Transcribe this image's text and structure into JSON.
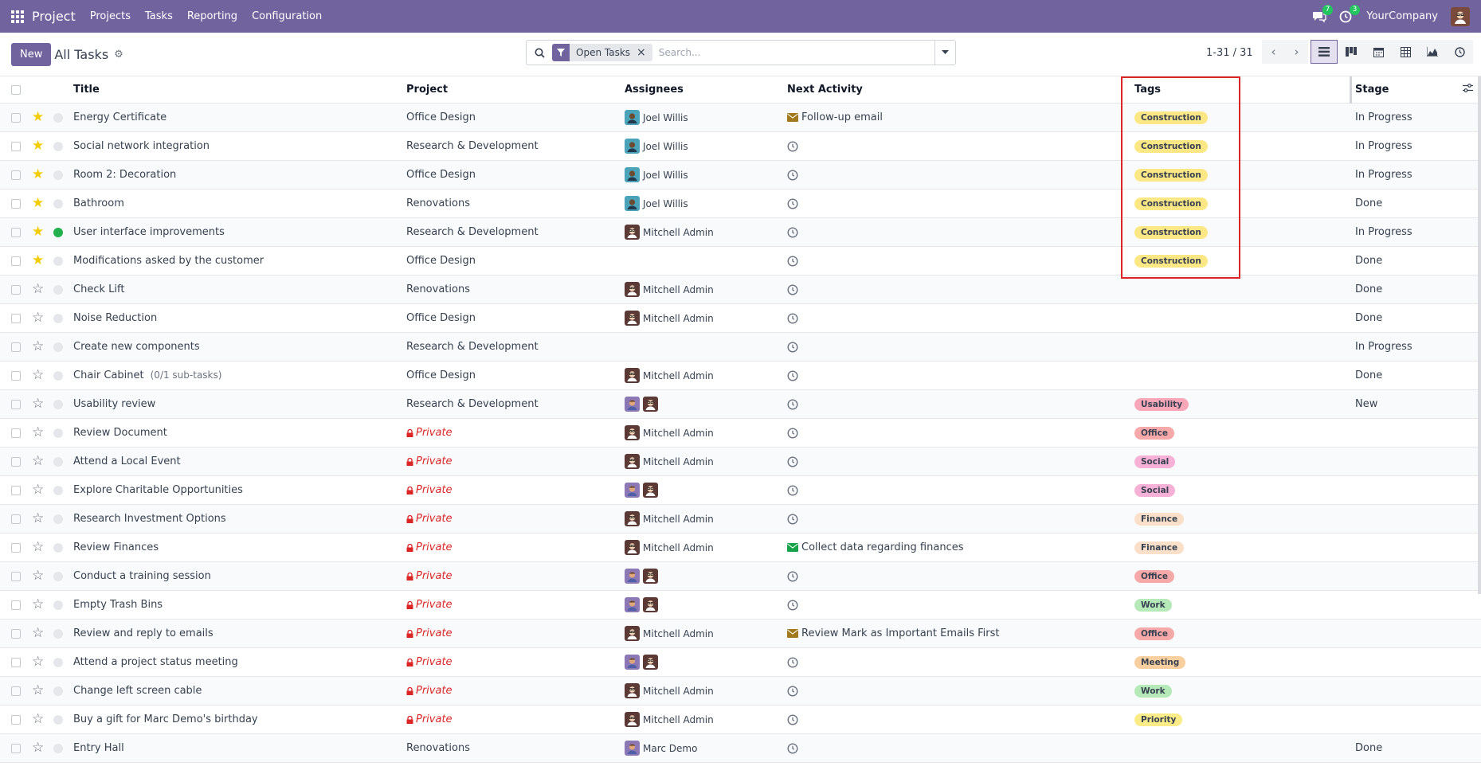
{
  "navbar": {
    "app_name": "Project",
    "menu": [
      "Projects",
      "Tasks",
      "Reporting",
      "Configuration"
    ],
    "messages_count": "7",
    "activities_count": "3",
    "company": "YourCompany",
    "brand_color": "#71639e"
  },
  "control": {
    "new_label": "New",
    "breadcrumb": "All Tasks",
    "filter_facet": "Open Tasks",
    "search_placeholder": "Search...",
    "pager": "1-31 / 31"
  },
  "columns": {
    "title": "Title",
    "project": "Project",
    "assignees": "Assignees",
    "next_activity": "Next Activity",
    "tags": "Tags",
    "stage": "Stage"
  },
  "tag_colors": {
    "Construction": "#fbe784",
    "Usability": "#f8a6b8",
    "Office": "#f7a8a8",
    "Social": "#f7b0d6",
    "Finance": "#fadfc9",
    "Work": "#b6e9b8",
    "Meeting": "#f9cfa0",
    "Priority": "#fbec88"
  },
  "rows": [
    {
      "title": "Energy Certificate",
      "sub": "",
      "starred": true,
      "dot": "",
      "project": "Office Design",
      "private": false,
      "assignees": [
        "joel"
      ],
      "assignee_label": "Joel Willis",
      "activity_type": "email",
      "activity_color": "#a07a1c",
      "activity": "Follow-up email",
      "tag": "Construction",
      "stage": "In Progress"
    },
    {
      "title": "Social network integration",
      "sub": "",
      "starred": true,
      "dot": "",
      "project": "Research & Development",
      "private": false,
      "assignees": [
        "joel"
      ],
      "assignee_label": "Joel Willis",
      "activity_type": "clock",
      "activity": "",
      "tag": "Construction",
      "stage": "In Progress"
    },
    {
      "title": "Room 2: Decoration",
      "sub": "",
      "starred": true,
      "dot": "",
      "project": "Office Design",
      "private": false,
      "assignees": [
        "joel"
      ],
      "assignee_label": "Joel Willis",
      "activity_type": "clock",
      "activity": "",
      "tag": "Construction",
      "stage": "In Progress"
    },
    {
      "title": "Bathroom",
      "sub": "",
      "starred": true,
      "dot": "",
      "project": "Renovations",
      "private": false,
      "assignees": [
        "joel"
      ],
      "assignee_label": "Joel Willis",
      "activity_type": "clock",
      "activity": "",
      "tag": "Construction",
      "stage": "Done"
    },
    {
      "title": "User interface improvements",
      "sub": "",
      "starred": true,
      "dot": "green",
      "project": "Research & Development",
      "private": false,
      "assignees": [
        "mitch"
      ],
      "assignee_label": "Mitchell Admin",
      "activity_type": "clock",
      "activity": "",
      "tag": "Construction",
      "stage": "In Progress"
    },
    {
      "title": "Modifications asked by the customer",
      "sub": "",
      "starred": true,
      "dot": "",
      "project": "Office Design",
      "private": false,
      "assignees": [],
      "assignee_label": "",
      "activity_type": "clock",
      "activity": "",
      "tag": "Construction",
      "stage": "Done"
    },
    {
      "title": "Check Lift",
      "sub": "",
      "starred": false,
      "dot": "",
      "project": "Renovations",
      "private": false,
      "assignees": [
        "mitch"
      ],
      "assignee_label": "Mitchell Admin",
      "activity_type": "clock",
      "activity": "",
      "tag": "",
      "stage": "Done"
    },
    {
      "title": "Noise Reduction",
      "sub": "",
      "starred": false,
      "dot": "",
      "project": "Office Design",
      "private": false,
      "assignees": [
        "mitch"
      ],
      "assignee_label": "Mitchell Admin",
      "activity_type": "clock",
      "activity": "",
      "tag": "",
      "stage": "Done"
    },
    {
      "title": "Create new components",
      "sub": "",
      "starred": false,
      "dot": "",
      "project": "Research & Development",
      "private": false,
      "assignees": [],
      "assignee_label": "",
      "activity_type": "clock",
      "activity": "",
      "tag": "",
      "stage": "In Progress"
    },
    {
      "title": "Chair Cabinet",
      "sub": "(0/1 sub-tasks)",
      "starred": false,
      "dot": "",
      "project": "Office Design",
      "private": false,
      "assignees": [
        "mitch"
      ],
      "assignee_label": "Mitchell Admin",
      "activity_type": "clock",
      "activity": "",
      "tag": "",
      "stage": "Done"
    },
    {
      "title": "Usability review",
      "sub": "",
      "starred": false,
      "dot": "",
      "project": "Research & Development",
      "private": false,
      "assignees": [
        "marc",
        "mitch"
      ],
      "assignee_label": "",
      "activity_type": "clock",
      "activity": "",
      "tag": "Usability",
      "stage": "New"
    },
    {
      "title": "Review Document",
      "sub": "",
      "starred": false,
      "dot": "",
      "project": "Private",
      "private": true,
      "assignees": [
        "mitch"
      ],
      "assignee_label": "Mitchell Admin",
      "activity_type": "clock",
      "activity": "",
      "tag": "Office",
      "stage": ""
    },
    {
      "title": "Attend a Local Event",
      "sub": "",
      "starred": false,
      "dot": "",
      "project": "Private",
      "private": true,
      "assignees": [
        "mitch"
      ],
      "assignee_label": "Mitchell Admin",
      "activity_type": "clock",
      "activity": "",
      "tag": "Social",
      "stage": ""
    },
    {
      "title": "Explore Charitable Opportunities",
      "sub": "",
      "starred": false,
      "dot": "",
      "project": "Private",
      "private": true,
      "assignees": [
        "marc",
        "mitch"
      ],
      "assignee_label": "",
      "activity_type": "clock",
      "activity": "",
      "tag": "Social",
      "stage": ""
    },
    {
      "title": "Research Investment Options",
      "sub": "",
      "starred": false,
      "dot": "",
      "project": "Private",
      "private": true,
      "assignees": [
        "mitch"
      ],
      "assignee_label": "Mitchell Admin",
      "activity_type": "clock",
      "activity": "",
      "tag": "Finance",
      "stage": ""
    },
    {
      "title": "Review Finances",
      "sub": "",
      "starred": false,
      "dot": "",
      "project": "Private",
      "private": true,
      "assignees": [
        "mitch"
      ],
      "assignee_label": "Mitchell Admin",
      "activity_type": "email",
      "activity_color": "#16a34a",
      "activity": "Collect data regarding finances",
      "tag": "Finance",
      "stage": ""
    },
    {
      "title": "Conduct a training session",
      "sub": "",
      "starred": false,
      "dot": "",
      "project": "Private",
      "private": true,
      "assignees": [
        "marc",
        "mitch"
      ],
      "assignee_label": "",
      "activity_type": "clock",
      "activity": "",
      "tag": "Office",
      "stage": ""
    },
    {
      "title": "Empty Trash Bins",
      "sub": "",
      "starred": false,
      "dot": "",
      "project": "Private",
      "private": true,
      "assignees": [
        "marc",
        "mitch"
      ],
      "assignee_label": "",
      "activity_type": "clock",
      "activity": "",
      "tag": "Work",
      "stage": ""
    },
    {
      "title": "Review and reply to emails",
      "sub": "",
      "starred": false,
      "dot": "",
      "project": "Private",
      "private": true,
      "assignees": [
        "mitch"
      ],
      "assignee_label": "Mitchell Admin",
      "activity_type": "email",
      "activity_color": "#a07a1c",
      "activity": "Review Mark as Important Emails First",
      "tag": "Office",
      "stage": ""
    },
    {
      "title": "Attend a project status meeting",
      "sub": "",
      "starred": false,
      "dot": "",
      "project": "Private",
      "private": true,
      "assignees": [
        "marc",
        "mitch"
      ],
      "assignee_label": "",
      "activity_type": "clock",
      "activity": "",
      "tag": "Meeting",
      "stage": ""
    },
    {
      "title": "Change left screen cable",
      "sub": "",
      "starred": false,
      "dot": "",
      "project": "Private",
      "private": true,
      "assignees": [
        "mitch"
      ],
      "assignee_label": "Mitchell Admin",
      "activity_type": "clock",
      "activity": "",
      "tag": "Work",
      "stage": ""
    },
    {
      "title": "Buy a gift for Marc Demo's birthday",
      "sub": "",
      "starred": false,
      "dot": "",
      "project": "Private",
      "private": true,
      "assignees": [
        "mitch"
      ],
      "assignee_label": "Mitchell Admin",
      "activity_type": "clock",
      "activity": "",
      "tag": "Priority",
      "stage": ""
    },
    {
      "title": "Entry Hall",
      "sub": "",
      "starred": false,
      "dot": "",
      "project": "Renovations",
      "private": false,
      "assignees": [
        "marc"
      ],
      "assignee_label": "Marc Demo",
      "activity_type": "clock",
      "activity": "",
      "tag": "",
      "stage": "Done"
    }
  ]
}
